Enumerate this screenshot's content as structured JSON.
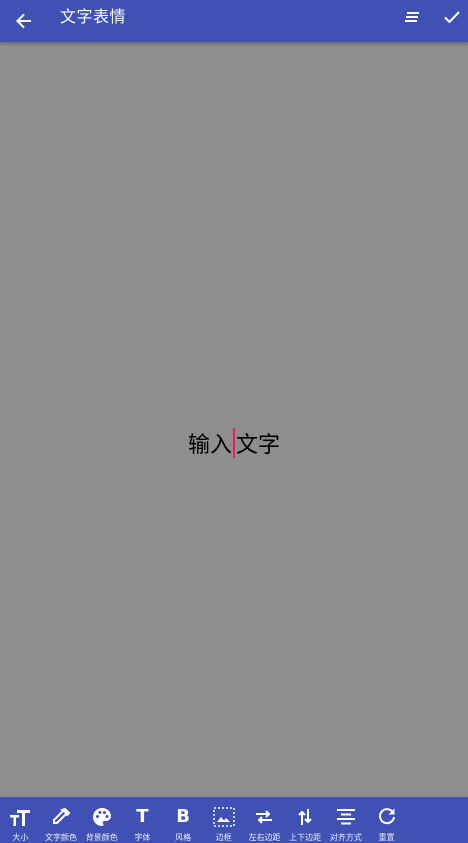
{
  "appbar": {
    "title": "文字表情",
    "back_icon": "arrow-back-icon",
    "align_icon": "align-icon",
    "done_icon": "check-icon",
    "color": "#3f51b5"
  },
  "editor": {
    "text_before_cursor": "输入",
    "text_after_cursor": "文字",
    "cursor_color": "#e91e63",
    "background": "#8e8e8e"
  },
  "toolbar": {
    "items": [
      {
        "label": "大小",
        "icon": "text-size-icon"
      },
      {
        "label": "文字颜色",
        "icon": "eyedropper-icon"
      },
      {
        "label": "背景颜色",
        "icon": "palette-icon"
      },
      {
        "label": "字体",
        "icon": "font-icon",
        "glyph": "T"
      },
      {
        "label": "风格",
        "icon": "bold-icon",
        "glyph": "B"
      },
      {
        "label": "边框",
        "icon": "border-icon"
      },
      {
        "label": "左右边距",
        "icon": "horizontal-spacing-icon"
      },
      {
        "label": "上下边距",
        "icon": "vertical-spacing-icon"
      },
      {
        "label": "对齐方式",
        "icon": "align-center-icon"
      },
      {
        "label": "重置",
        "icon": "reset-icon"
      }
    ]
  }
}
